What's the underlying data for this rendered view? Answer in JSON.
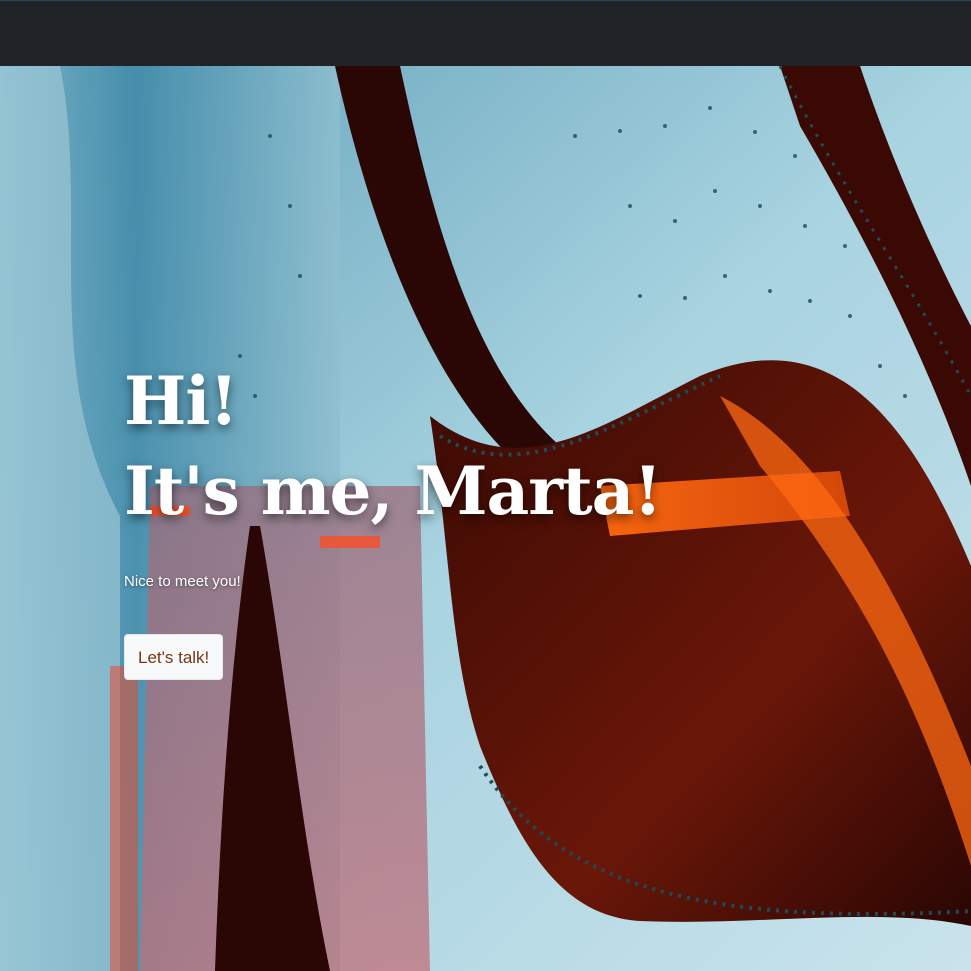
{
  "hero": {
    "title_line1": "Hi!",
    "title_line2": "It's me, Marta!",
    "subtitle": "Nice to meet you!",
    "cta_label": "Let's talk!"
  },
  "colors": {
    "navbar": "#202328",
    "cta_text": "#7a3510",
    "cta_background": "#f8f9fb"
  }
}
